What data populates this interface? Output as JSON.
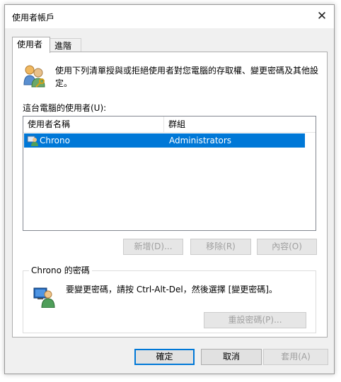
{
  "window": {
    "title": "使用者帳戶",
    "close_glyph": "✕"
  },
  "tabs": [
    {
      "label": "使用者"
    },
    {
      "label": "進階"
    }
  ],
  "intro": {
    "text": "使用下列清單授與或拒絕使用者對您電腦的存取權、變更密碼及其他設定。"
  },
  "users_list": {
    "label": "這台電腦的使用者(U):",
    "columns": [
      "使用者名稱",
      "群組"
    ],
    "rows": [
      {
        "name": "Chrono",
        "group": "Administrators",
        "selected": true
      }
    ]
  },
  "list_buttons": {
    "add": "新增(D)...",
    "remove": "移除(R)",
    "properties": "內容(O)"
  },
  "password_group": {
    "title": "Chrono 的密碼",
    "text": "要變更密碼，請按 Ctrl-Alt-Del，然後選擇 [變更密碼]。",
    "reset_button": "重設密碼(P)..."
  },
  "footer": {
    "ok": "確定",
    "cancel": "取消",
    "apply": "套用(A)"
  },
  "colors": {
    "selection": "#0078d7",
    "default_button_border": "#0078d7",
    "disabled_text": "#a0a0a0"
  }
}
